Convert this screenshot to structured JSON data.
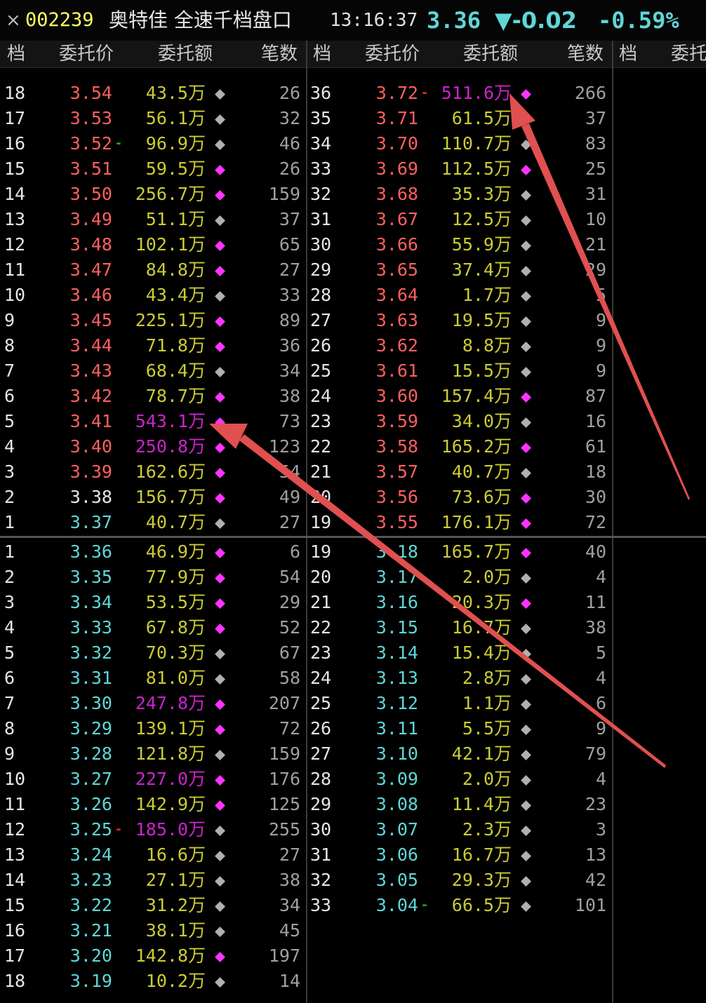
{
  "titlebar": {
    "close_glyph": "×",
    "code": "002239",
    "name": "奥特佳 全速千档盘口",
    "time": "13:16:37",
    "price": "3.36",
    "change": "▼-0.02",
    "change_pct": "-0.59%"
  },
  "headers": {
    "col1": [
      "档",
      "委托价",
      "委托额",
      "笔数"
    ],
    "col2": [
      "档",
      "委托价",
      "委托额",
      "笔数"
    ],
    "col3": [
      "档",
      "委托"
    ]
  },
  "unit": "万",
  "colors": {
    "sell_price": "#ff5f5f",
    "buy_price": "#5fd7d7",
    "neutral_price": "#e6e6e6",
    "amount_normal": "#cccc33",
    "amount_large": "#cc22cc",
    "dot_small": "#b0b0b0",
    "dot_large": "#ff33ff",
    "arrow": "#e05050"
  },
  "sell_left": [
    {
      "lvl": "18",
      "price": "3.54",
      "amt": "43.5",
      "cnt": "26",
      "dot": "small"
    },
    {
      "lvl": "17",
      "price": "3.53",
      "amt": "56.1",
      "cnt": "32",
      "dot": "small"
    },
    {
      "lvl": "16",
      "price": "3.52",
      "amt": "96.9",
      "cnt": "46",
      "dot": "small",
      "mark": "green"
    },
    {
      "lvl": "15",
      "price": "3.51",
      "amt": "59.5",
      "cnt": "26",
      "dot": "large"
    },
    {
      "lvl": "14",
      "price": "3.50",
      "amt": "256.7",
      "cnt": "159",
      "dot": "large"
    },
    {
      "lvl": "13",
      "price": "3.49",
      "amt": "51.1",
      "cnt": "37",
      "dot": "small"
    },
    {
      "lvl": "12",
      "price": "3.48",
      "amt": "102.1",
      "cnt": "65",
      "dot": "large"
    },
    {
      "lvl": "11",
      "price": "3.47",
      "amt": "84.8",
      "cnt": "27",
      "dot": "large"
    },
    {
      "lvl": "10",
      "price": "3.46",
      "amt": "43.4",
      "cnt": "33",
      "dot": "small"
    },
    {
      "lvl": "9",
      "price": "3.45",
      "amt": "225.1",
      "cnt": "89",
      "dot": "large"
    },
    {
      "lvl": "8",
      "price": "3.44",
      "amt": "71.8",
      "cnt": "36",
      "dot": "large"
    },
    {
      "lvl": "7",
      "price": "3.43",
      "amt": "68.4",
      "cnt": "34",
      "dot": "small"
    },
    {
      "lvl": "6",
      "price": "3.42",
      "amt": "78.7",
      "cnt": "38",
      "dot": "large"
    },
    {
      "lvl": "5",
      "price": "3.41",
      "amt": "543.1",
      "cnt": "73",
      "dot": "large",
      "big": true
    },
    {
      "lvl": "4",
      "price": "3.40",
      "amt": "250.8",
      "cnt": "123",
      "dot": "large",
      "big": true
    },
    {
      "lvl": "3",
      "price": "3.39",
      "amt": "162.6",
      "cnt": "54",
      "dot": "large"
    },
    {
      "lvl": "2",
      "price": "3.38",
      "amt": "156.7",
      "cnt": "49",
      "dot": "large",
      "neutral": true
    },
    {
      "lvl": "1",
      "price": "3.37",
      "amt": "40.7",
      "cnt": "27",
      "dot": "small",
      "buycolor": true
    }
  ],
  "sell_right": [
    {
      "lvl": "36",
      "price": "3.72",
      "amt": "511.6",
      "cnt": "266",
      "dot": "large",
      "big": true,
      "mark": "red"
    },
    {
      "lvl": "35",
      "price": "3.71",
      "amt": "61.5",
      "cnt": "37",
      "dot": "large"
    },
    {
      "lvl": "34",
      "price": "3.70",
      "amt": "110.7",
      "cnt": "83",
      "dot": "small"
    },
    {
      "lvl": "33",
      "price": "3.69",
      "amt": "112.5",
      "cnt": "25",
      "dot": "large"
    },
    {
      "lvl": "32",
      "price": "3.68",
      "amt": "35.3",
      "cnt": "31",
      "dot": "small"
    },
    {
      "lvl": "31",
      "price": "3.67",
      "amt": "12.5",
      "cnt": "10",
      "dot": "small"
    },
    {
      "lvl": "30",
      "price": "3.66",
      "amt": "55.9",
      "cnt": "21",
      "dot": "small"
    },
    {
      "lvl": "29",
      "price": "3.65",
      "amt": "37.4",
      "cnt": "29",
      "dot": "small"
    },
    {
      "lvl": "28",
      "price": "3.64",
      "amt": "1.7",
      "cnt": "5",
      "dot": "small"
    },
    {
      "lvl": "27",
      "price": "3.63",
      "amt": "19.5",
      "cnt": "9",
      "dot": "small"
    },
    {
      "lvl": "26",
      "price": "3.62",
      "amt": "8.8",
      "cnt": "9",
      "dot": "small"
    },
    {
      "lvl": "25",
      "price": "3.61",
      "amt": "15.5",
      "cnt": "9",
      "dot": "small"
    },
    {
      "lvl": "24",
      "price": "3.60",
      "amt": "157.4",
      "cnt": "87",
      "dot": "large"
    },
    {
      "lvl": "23",
      "price": "3.59",
      "amt": "34.0",
      "cnt": "16",
      "dot": "small"
    },
    {
      "lvl": "22",
      "price": "3.58",
      "amt": "165.2",
      "cnt": "61",
      "dot": "large"
    },
    {
      "lvl": "21",
      "price": "3.57",
      "amt": "40.7",
      "cnt": "18",
      "dot": "small"
    },
    {
      "lvl": "20",
      "price": "3.56",
      "amt": "73.6",
      "cnt": "30",
      "dot": "large"
    },
    {
      "lvl": "19",
      "price": "3.55",
      "amt": "176.1",
      "cnt": "72",
      "dot": "large"
    }
  ],
  "buy_left": [
    {
      "lvl": "1",
      "price": "3.36",
      "amt": "46.9",
      "cnt": "6",
      "dot": "large"
    },
    {
      "lvl": "2",
      "price": "3.35",
      "amt": "77.9",
      "cnt": "54",
      "dot": "large"
    },
    {
      "lvl": "3",
      "price": "3.34",
      "amt": "53.5",
      "cnt": "29",
      "dot": "large"
    },
    {
      "lvl": "4",
      "price": "3.33",
      "amt": "67.8",
      "cnt": "52",
      "dot": "large"
    },
    {
      "lvl": "5",
      "price": "3.32",
      "amt": "70.3",
      "cnt": "67",
      "dot": "small"
    },
    {
      "lvl": "6",
      "price": "3.31",
      "amt": "81.0",
      "cnt": "58",
      "dot": "small"
    },
    {
      "lvl": "7",
      "price": "3.30",
      "amt": "247.8",
      "cnt": "207",
      "dot": "large",
      "big": true
    },
    {
      "lvl": "8",
      "price": "3.29",
      "amt": "139.1",
      "cnt": "72",
      "dot": "large"
    },
    {
      "lvl": "9",
      "price": "3.28",
      "amt": "121.8",
      "cnt": "159",
      "dot": "small"
    },
    {
      "lvl": "10",
      "price": "3.27",
      "amt": "227.0",
      "cnt": "176",
      "dot": "large",
      "big": true
    },
    {
      "lvl": "11",
      "price": "3.26",
      "amt": "142.9",
      "cnt": "125",
      "dot": "large"
    },
    {
      "lvl": "12",
      "price": "3.25",
      "amt": "185.0",
      "cnt": "255",
      "dot": "small",
      "big": true,
      "mark": "red"
    },
    {
      "lvl": "13",
      "price": "3.24",
      "amt": "16.6",
      "cnt": "27",
      "dot": "small"
    },
    {
      "lvl": "14",
      "price": "3.23",
      "amt": "27.1",
      "cnt": "38",
      "dot": "small"
    },
    {
      "lvl": "15",
      "price": "3.22",
      "amt": "31.2",
      "cnt": "34",
      "dot": "small"
    },
    {
      "lvl": "16",
      "price": "3.21",
      "amt": "38.1",
      "cnt": "45",
      "dot": "small"
    },
    {
      "lvl": "17",
      "price": "3.20",
      "amt": "142.8",
      "cnt": "197",
      "dot": "large"
    },
    {
      "lvl": "18",
      "price": "3.19",
      "amt": "10.2",
      "cnt": "14",
      "dot": "small"
    }
  ],
  "buy_right": [
    {
      "lvl": "19",
      "price": "3.18",
      "amt": "165.7",
      "cnt": "40",
      "dot": "large"
    },
    {
      "lvl": "20",
      "price": "3.17",
      "amt": "2.0",
      "cnt": "4",
      "dot": "small"
    },
    {
      "lvl": "21",
      "price": "3.16",
      "amt": "20.3",
      "cnt": "11",
      "dot": "large"
    },
    {
      "lvl": "22",
      "price": "3.15",
      "amt": "16.7",
      "cnt": "38",
      "dot": "small"
    },
    {
      "lvl": "23",
      "price": "3.14",
      "amt": "15.4",
      "cnt": "5",
      "dot": "small"
    },
    {
      "lvl": "24",
      "price": "3.13",
      "amt": "2.8",
      "cnt": "4",
      "dot": "small"
    },
    {
      "lvl": "25",
      "price": "3.12",
      "amt": "1.1",
      "cnt": "6",
      "dot": "small"
    },
    {
      "lvl": "26",
      "price": "3.11",
      "amt": "5.5",
      "cnt": "9",
      "dot": "small"
    },
    {
      "lvl": "27",
      "price": "3.10",
      "amt": "42.1",
      "cnt": "79",
      "dot": "small"
    },
    {
      "lvl": "28",
      "price": "3.09",
      "amt": "2.0",
      "cnt": "4",
      "dot": "small"
    },
    {
      "lvl": "29",
      "price": "3.08",
      "amt": "11.4",
      "cnt": "23",
      "dot": "small"
    },
    {
      "lvl": "30",
      "price": "3.07",
      "amt": "2.3",
      "cnt": "3",
      "dot": "small"
    },
    {
      "lvl": "31",
      "price": "3.06",
      "amt": "16.7",
      "cnt": "13",
      "dot": "small"
    },
    {
      "lvl": "32",
      "price": "3.05",
      "amt": "29.3",
      "cnt": "42",
      "dot": "small"
    },
    {
      "lvl": "33",
      "price": "3.04",
      "amt": "66.5",
      "cnt": "101",
      "dot": "small",
      "mark": "green"
    }
  ]
}
